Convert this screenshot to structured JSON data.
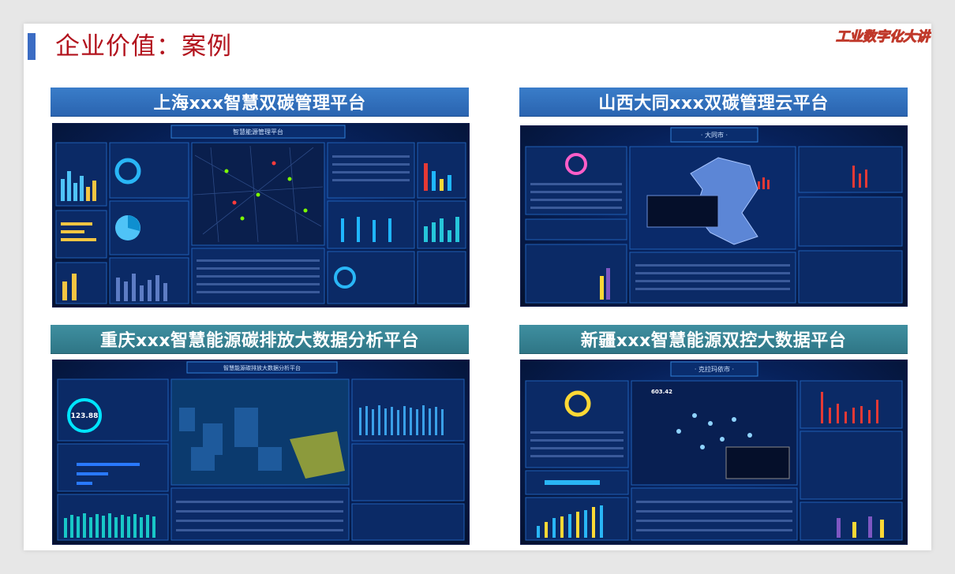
{
  "slide": {
    "title": "企业价值：案例",
    "brand": "工业数字化大讲"
  },
  "colors": {
    "title_red": "#b2131d",
    "accent_blue": "#3b6cc4",
    "header_blue": "#2a64b0",
    "header_teal": "#2f7686",
    "dashboard_bg": "#07215a"
  },
  "cases": [
    {
      "name": "上海xxx智慧双碳管理平台",
      "screen_title": "智慧能源管理平台",
      "big_number": ""
    },
    {
      "name": "山西大同xxx双碳管理云平台",
      "screen_title": "· 大同市 ·",
      "big_number": ""
    },
    {
      "name": "重庆xxx智慧能源碳排放大数据分析平台",
      "screen_title": "智慧能源碳排放大数据分析平台",
      "big_number": "123.88"
    },
    {
      "name": "新疆xxx智慧能源双控大数据平台",
      "screen_title": "· 克拉玛依市 ·",
      "big_number": "603.42"
    }
  ]
}
